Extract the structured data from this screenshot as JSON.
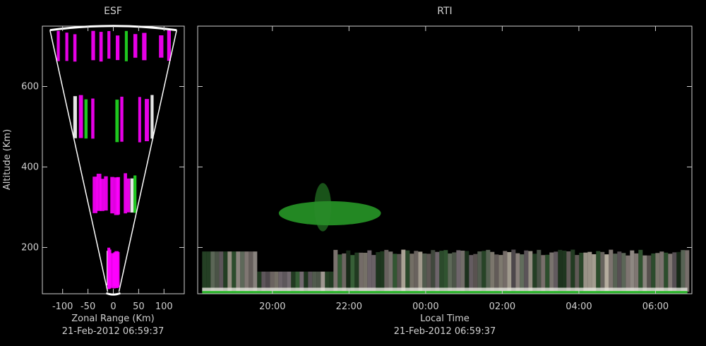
{
  "chart_data": [
    {
      "type": "scatter",
      "title": "ESF",
      "xlabel": "Zonal Range (Km)",
      "ylabel": "Altitude (Km)",
      "timestamp": "21-Feb-2012 06:59:37",
      "xlim": [
        -140,
        140
      ],
      "ylim": [
        85,
        750
      ],
      "x_ticks": [
        -100,
        -50,
        0,
        50,
        100
      ],
      "x_tick_labels": [
        "-100",
        "-50",
        "0",
        "50",
        "100"
      ],
      "y_ticks": [
        200,
        400,
        600
      ],
      "y_tick_labels": [
        "200",
        "400",
        "600"
      ],
      "fan_max_altitude": 740,
      "echo_bands": [
        {
          "alt_min": 660,
          "alt_max": 740,
          "color": "#ff00ff"
        },
        {
          "alt_min": 460,
          "alt_max": 580,
          "color": "#ff00ff"
        },
        {
          "alt_min": 280,
          "alt_max": 385,
          "color": "#ff00ff"
        },
        {
          "alt_min": 95,
          "alt_max": 200,
          "color": "#ff00ff"
        }
      ]
    },
    {
      "type": "heatmap",
      "title": "RTI",
      "xlabel": "Local Time",
      "timestamp": "21-Feb-2012 06:59:37",
      "x_ticks": [
        "20:00",
        "22:00",
        "00:00",
        "02:00",
        "04:00",
        "06:00"
      ],
      "ylim": [
        85,
        750
      ],
      "y_ticks": [
        200,
        400,
        600
      ],
      "echo_layers": [
        {
          "name": "F-layer plume",
          "start": "20:10",
          "end": "22:50",
          "alt_min": 240,
          "alt_max": 360,
          "color": "#2fb52f"
        },
        {
          "name": "Bottom layer",
          "start": "18:10",
          "end": "06:50",
          "alt_min": 90,
          "alt_max": 195,
          "color": "#8a8a7a"
        }
      ]
    }
  ]
}
